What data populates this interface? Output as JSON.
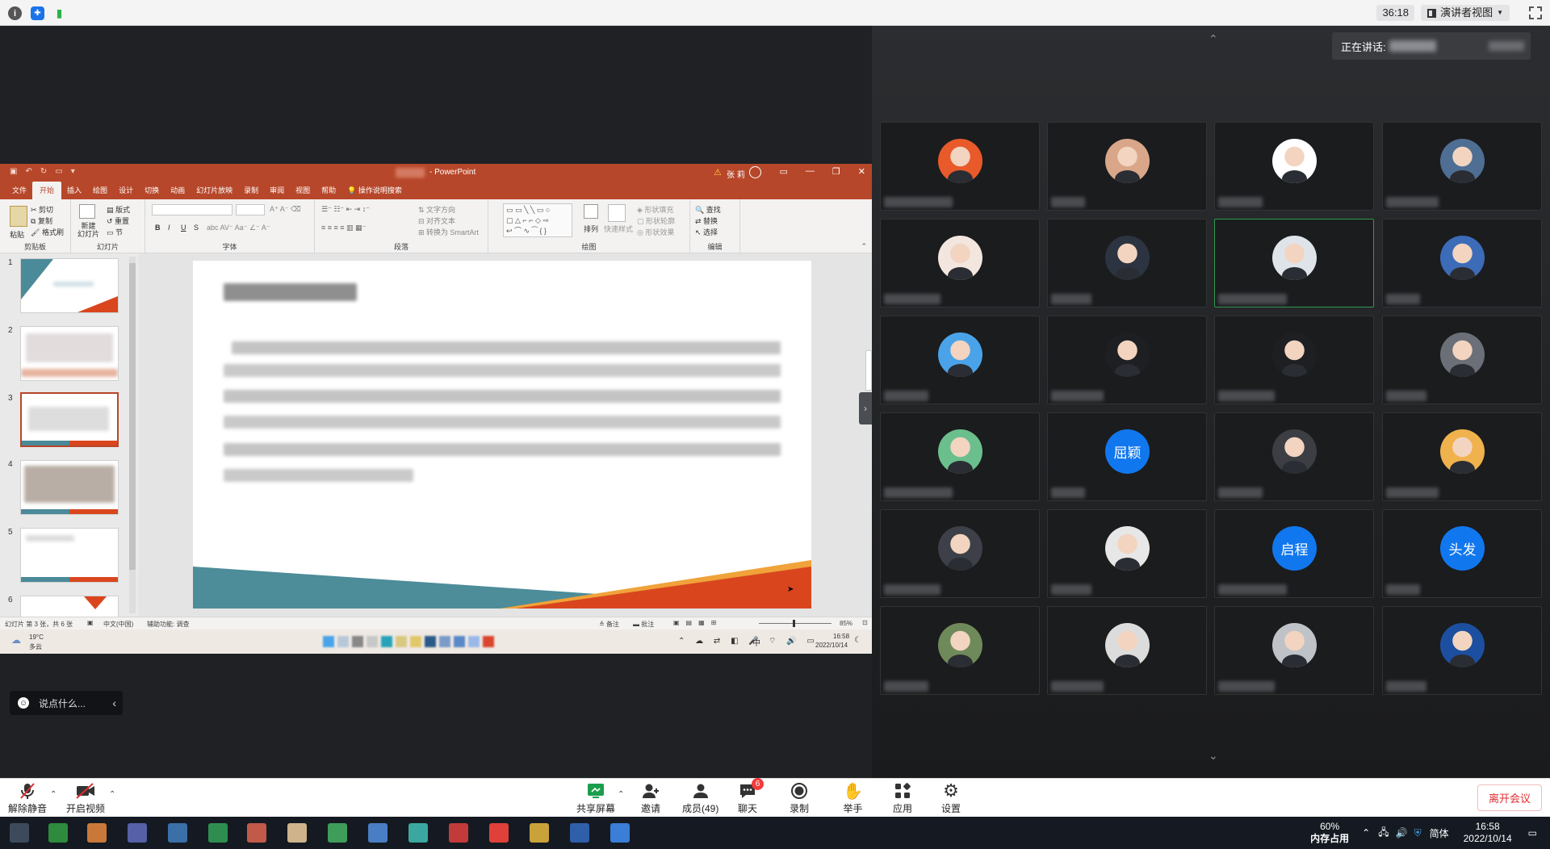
{
  "top_bar": {
    "timer": "36:18",
    "view_button": "演讲者视图"
  },
  "powerpoint": {
    "app_name": "PowerPoint",
    "title_suffix": "- PowerPoint",
    "user_label": "张 莉",
    "tabs": [
      "文件",
      "开始",
      "插入",
      "绘图",
      "设计",
      "切换",
      "动画",
      "幻灯片放映",
      "录制",
      "审阅",
      "视图",
      "帮助",
      "操作说明搜索"
    ],
    "active_tab": "开始",
    "ribbon": {
      "paste": "粘贴",
      "cut": "剪切",
      "copy": "复制",
      "format_painter": "格式刷",
      "clipboard": "剪贴板",
      "new_slide": "新建\n幻灯片",
      "layout": "版式",
      "reset": "重置",
      "section": "节",
      "slides": "幻灯片",
      "font": "字体",
      "paragraph": "段落",
      "text_direction": "文字方向",
      "align_text": "对齐文本",
      "smartart": "转换为 SmartArt",
      "drawing": "绘图",
      "arrange": "排列",
      "quick_styles": "快速样式",
      "shape_fill": "形状填充",
      "shape_outline": "形状轮廓",
      "shape_effects": "形状效果",
      "find": "查找",
      "replace": "替换",
      "select": "选择",
      "editing": "编辑"
    },
    "thumb_numbers": [
      "1",
      "2",
      "3",
      "4",
      "5",
      "6"
    ],
    "status": {
      "slide_info": "幻灯片 第 3 张，共 6 张",
      "language": "中文(中国)",
      "accessibility": "辅助功能: 调查",
      "notes": "备注",
      "comments": "批注",
      "zoom": "85%"
    },
    "win_inner_taskbar": {
      "weather_temp": "19°C",
      "weather_desc": "多云",
      "time": "16:58",
      "date": "2022/10/14",
      "ime": "中"
    }
  },
  "chat_pill": {
    "placeholder": "说点什么..."
  },
  "speaking": {
    "label": "正在讲话:"
  },
  "participants": [
    {
      "type": "img",
      "icon": "lion-avatar-icon",
      "color": "#e85a2a"
    },
    {
      "type": "img",
      "icon": "woman-avatar-icon",
      "color": "#d9a68a"
    },
    {
      "type": "img",
      "icon": "logo-avatar-icon",
      "color": "#ffffff"
    },
    {
      "type": "img",
      "icon": "city-avatar-icon",
      "color": "#4f6e93"
    },
    {
      "type": "img",
      "icon": "woman-avatar-icon",
      "color": "#f2e6de"
    },
    {
      "type": "img",
      "icon": "man-avatar-icon",
      "color": "#2b3440"
    },
    {
      "type": "img",
      "icon": "man-avatar-icon",
      "color": "#dfe4ea",
      "active": true
    },
    {
      "type": "img",
      "icon": "man-avatar-icon",
      "color": "#3c6bb8"
    },
    {
      "type": "img",
      "icon": "man-avatar-icon",
      "color": "#4aa3e8"
    },
    {
      "type": "img",
      "icon": "woman-avatar-icon",
      "color": "#1e1f22"
    },
    {
      "type": "img",
      "icon": "woman-avatar-icon",
      "color": "#1e1f22"
    },
    {
      "type": "img",
      "icon": "man-avatar-icon",
      "color": "#6b6f77"
    },
    {
      "type": "img",
      "icon": "woman-avatar-icon",
      "color": "#6bbf8d"
    },
    {
      "type": "text",
      "text": "屈颖"
    },
    {
      "type": "img",
      "icon": "man-avatar-icon",
      "color": "#3c3e43"
    },
    {
      "type": "img",
      "icon": "woman-avatar-icon",
      "color": "#f0b24d"
    },
    {
      "type": "img",
      "icon": "scene-avatar-icon",
      "color": "#3d4048"
    },
    {
      "type": "img",
      "icon": "woman-avatar-icon",
      "color": "#e7e7e7"
    },
    {
      "type": "text",
      "text": "启程"
    },
    {
      "type": "text",
      "text": "头发"
    },
    {
      "type": "img",
      "icon": "plant-avatar-icon",
      "color": "#6f8a5a"
    },
    {
      "type": "img",
      "icon": "sketch-avatar-icon",
      "color": "#dcdcdc"
    },
    {
      "type": "img",
      "icon": "man-avatar-icon",
      "color": "#bfc3c8"
    },
    {
      "type": "img",
      "icon": "man-avatar-icon",
      "color": "#1c4fa0"
    }
  ],
  "toolbar": {
    "unmute": "解除静音",
    "start_video": "开启视频",
    "share_screen": "共享屏幕",
    "invite": "邀请",
    "members": "成员(49)",
    "chat": "聊天",
    "chat_badge": "6",
    "record": "录制",
    "raise_hand": "举手",
    "apps": "应用",
    "settings": "设置",
    "leave": "离开会议"
  },
  "taskbar": {
    "memory_pct": "60%",
    "memory_label": "内存占用",
    "ime": "简体",
    "time": "16:58",
    "date": "2022/10/14"
  },
  "colors": {
    "ppt_accent": "#b7472a",
    "zoom_blue": "#1177ee",
    "leave_red": "#e02e2e",
    "active_speaker_green": "#2f9a4f"
  }
}
